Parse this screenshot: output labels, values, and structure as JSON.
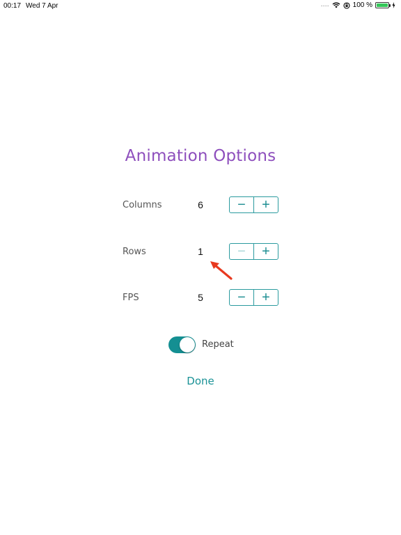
{
  "status_bar": {
    "time": "00:17",
    "date": "Wed 7 Apr",
    "battery": "100 %",
    "icons": [
      "cellular-dots-icon",
      "wifi-icon",
      "orientation-lock-icon",
      "battery-icon",
      "charging-icon"
    ]
  },
  "title": "Animation Options",
  "options": [
    {
      "label": "Columns",
      "value": "6",
      "minus_enabled": true,
      "plus_enabled": true
    },
    {
      "label": "Rows",
      "value": "1",
      "minus_enabled": false,
      "plus_enabled": true
    },
    {
      "label": "FPS",
      "value": "5",
      "minus_enabled": true,
      "plus_enabled": true
    }
  ],
  "stepper": {
    "minus_symbol": "−",
    "plus_symbol": "+"
  },
  "repeat": {
    "label": "Repeat",
    "on": true
  },
  "done_label": "Done",
  "colors": {
    "title": "#8e4fbd",
    "accent": "#1f8f93",
    "annotation_arrow": "#e8391f",
    "battery": "#34c759"
  }
}
